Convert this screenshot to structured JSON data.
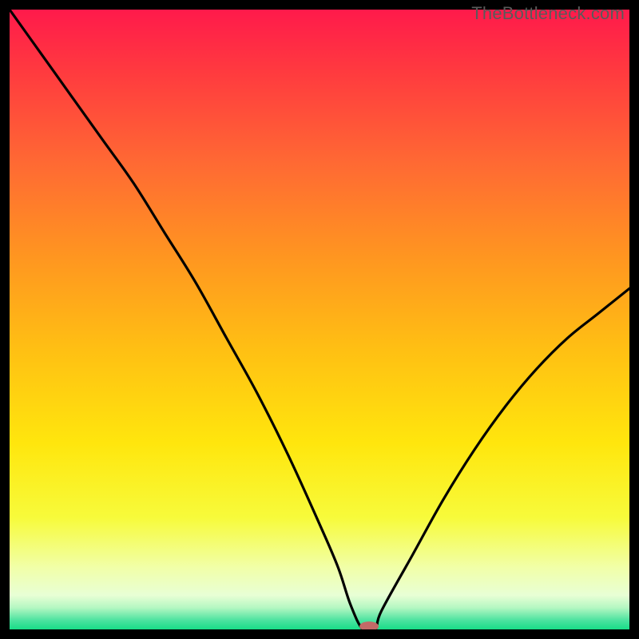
{
  "watermark": "TheBottleneck.com",
  "chart_data": {
    "type": "line",
    "title": "",
    "xlabel": "",
    "ylabel": "",
    "xlim": [
      0,
      100
    ],
    "ylim": [
      0,
      100
    ],
    "grid": false,
    "series": [
      {
        "name": "bottleneck-curve",
        "x": [
          0,
          5,
          10,
          15,
          20,
          25,
          30,
          35,
          40,
          45,
          50,
          53,
          55,
          57,
          59,
          60,
          65,
          70,
          75,
          80,
          85,
          90,
          95,
          100
        ],
        "y": [
          100,
          93,
          86,
          79,
          72,
          64,
          56,
          47,
          38,
          28,
          17,
          10,
          4,
          0,
          0,
          3,
          12,
          21,
          29,
          36,
          42,
          47,
          51,
          55
        ]
      }
    ],
    "marker": {
      "x": 58,
      "y": 0.5,
      "color": "#c26a67",
      "rx": 12,
      "ry": 6
    },
    "gradient_stops": [
      {
        "offset": 0.0,
        "color": "#ff1a4b"
      },
      {
        "offset": 0.1,
        "color": "#ff3a3f"
      },
      {
        "offset": 0.25,
        "color": "#ff6a33"
      },
      {
        "offset": 0.4,
        "color": "#ff9620"
      },
      {
        "offset": 0.55,
        "color": "#ffc013"
      },
      {
        "offset": 0.7,
        "color": "#ffe60d"
      },
      {
        "offset": 0.82,
        "color": "#f7fb3b"
      },
      {
        "offset": 0.9,
        "color": "#f1ffa8"
      },
      {
        "offset": 0.945,
        "color": "#e8ffd5"
      },
      {
        "offset": 0.965,
        "color": "#b4f7c2"
      },
      {
        "offset": 0.985,
        "color": "#4de3a0"
      },
      {
        "offset": 1.0,
        "color": "#18dd87"
      }
    ]
  }
}
